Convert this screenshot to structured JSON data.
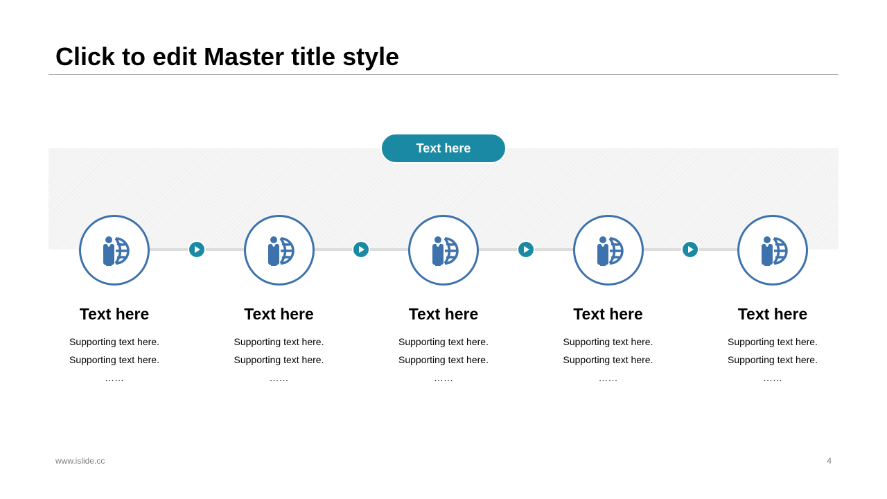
{
  "slide": {
    "title": "Click to edit Master title style"
  },
  "banner": {
    "label": "Text here"
  },
  "steps": [
    {
      "title": "Text here",
      "line1": "Supporting text here.",
      "line2": "Supporting text here.",
      "line3": "……",
      "icon": "businessman-globe-icon"
    },
    {
      "title": "Text here",
      "line1": "Supporting text here.",
      "line2": "Supporting text here.",
      "line3": "……",
      "icon": "businessman-globe-icon"
    },
    {
      "title": "Text here",
      "line1": "Supporting text here.",
      "line2": "Supporting text here.",
      "line3": "……",
      "icon": "businessman-globe-icon"
    },
    {
      "title": "Text here",
      "line1": "Supporting text here.",
      "line2": "Supporting text here.",
      "line3": "……",
      "icon": "businessman-globe-icon"
    },
    {
      "title": "Text here",
      "line1": "Supporting text here.",
      "line2": "Supporting text here.",
      "line3": "……",
      "icon": "businessman-globe-icon"
    }
  ],
  "connectors": {
    "icon": "play-arrow-icon",
    "count": 4
  },
  "footer": {
    "website": "www.islide.cc",
    "page_number": "4"
  },
  "colors": {
    "accent": "#1a8aa4",
    "icon_blue": "#3d72ad",
    "line": "#dddddd"
  }
}
